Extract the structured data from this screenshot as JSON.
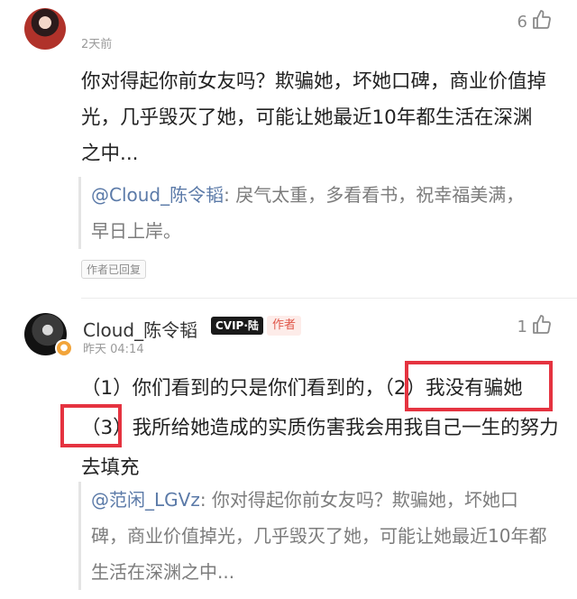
{
  "comment1": {
    "time": "2天前",
    "likes": "6",
    "text": "你对得起你前女友吗？欺骗她，坏她口碑，商业价值掉光，几乎毁灭了她，可能让她最近10年都生活在深渊之中...",
    "reply_mention": "@Cloud_陈令韬",
    "reply_text": ": 戾气太重，多看看书，祝幸福美满，早日上岸。",
    "author_replied_tag": "作者已回复"
  },
  "comment2": {
    "username": "Cloud_陈令韬",
    "vip_badge": "CVIP·陆",
    "author_badge": "作者",
    "time": "昨天 04:14",
    "likes": "1",
    "text": "（1）你们看到的只是你们看到的，（2）我没有骗她（3）我所给她造成的实质伤害我会用我自己一生的努力去填充",
    "quote_mention": "@范闲_LGVz",
    "quote_text": ": 你对得起你前女友吗？欺骗她，坏她口碑，商业价值掉光，几乎毁灭了她，可能让她最近10年都生活在深渊之中..."
  },
  "highlight_color": "#e53340",
  "icons": {
    "like": "thumbs-up-icon",
    "avatar_badge": "badge-icon"
  }
}
